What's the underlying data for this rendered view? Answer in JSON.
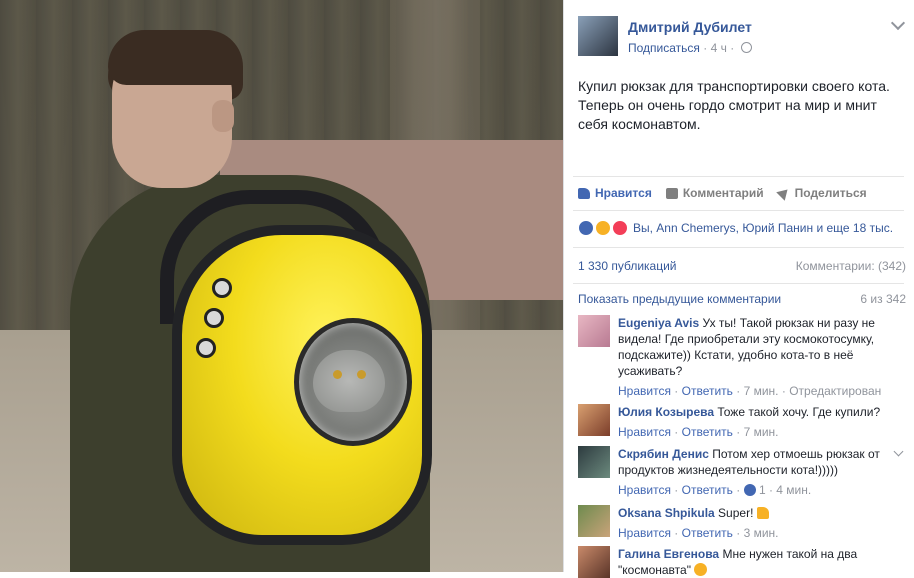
{
  "post": {
    "author": "Дмитрий Дубилет",
    "subscribe": "Подписаться",
    "time": "4 ч",
    "text": "Купил рюкзак для транспортировки своего кота. Теперь он очень гордо смотрит на мир и мнит себя космонавтом."
  },
  "actions": {
    "like": "Нравится",
    "comment": "Комментарий",
    "share": "Поделиться"
  },
  "reactions": {
    "text": "Вы, Ann Chemerys, Юрий Панин и еще 18 тыс."
  },
  "stats": {
    "shares": "1 330 публикаций",
    "comments": "Комментарии: (342)"
  },
  "previous": {
    "label": "Показать предыдущие комментарии",
    "count": "6 из 342"
  },
  "comments": [
    {
      "name": "Eugeniya Avis",
      "text": "Ух ты! Такой рюкзак ни разу не видела! Где приобретали эту космокотосумку, подскажите)) Кстати, удобно кота-то в неё усаживать?",
      "like": "Нравится",
      "reply": "Ответить",
      "time": "7 мин.",
      "extra": "Отредактирован"
    },
    {
      "name": "Юлия Козырева",
      "text": "Тоже такой хочу. Где купили?",
      "like": "Нравится",
      "reply": "Ответить",
      "time": "7 мин."
    },
    {
      "name": "Скрябин Денис",
      "text": "Потом хер отмоешь рюкзак от продуктов жизнедеятельности кота!)))))",
      "like": "Нравится",
      "reply": "Ответить",
      "likes": "1",
      "time": "4 мин."
    },
    {
      "name": "Oksana Shpikula",
      "text": "Super!",
      "like": "Нравится",
      "reply": "Ответить",
      "time": "3 мин."
    },
    {
      "name": "Галина Евгенова",
      "text": "Мне нужен такой на два \"космонавта\""
    }
  ]
}
